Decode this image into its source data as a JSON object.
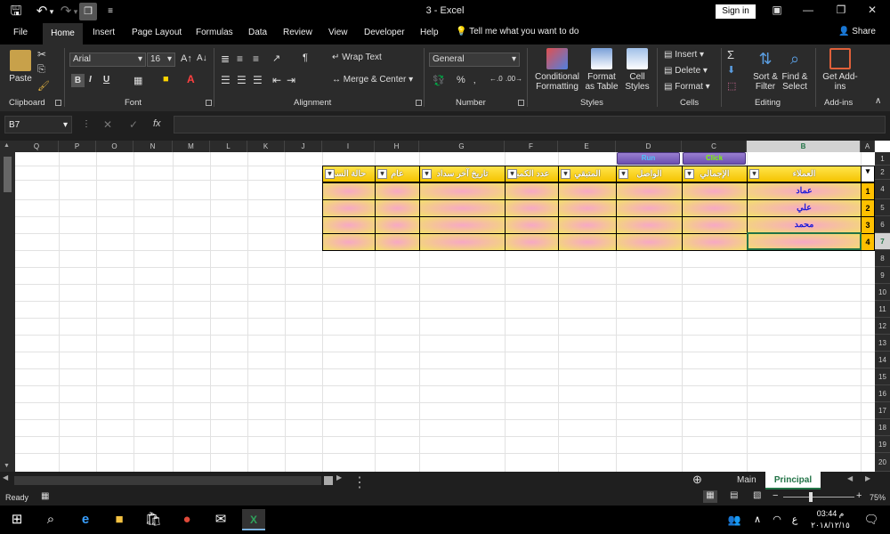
{
  "titlebar": {
    "doc_title": "3 - Excel",
    "signin_label": "Sign in"
  },
  "tabs": [
    "File",
    "Home",
    "Insert",
    "Page Layout",
    "Formulas",
    "Data",
    "Review",
    "View",
    "Developer",
    "Help"
  ],
  "tell_me": "Tell me what you want to do",
  "share_label": "Share",
  "ribbon": {
    "clipboard": {
      "label": "Clipboard",
      "paste": "Paste"
    },
    "font": {
      "label": "Font",
      "name": "Arial",
      "size": "16",
      "bold": "B",
      "italic": "I",
      "underline": "U"
    },
    "alignment": {
      "label": "Alignment",
      "wrap": "Wrap Text",
      "merge": "Merge & Center"
    },
    "number": {
      "label": "Number",
      "format": "General",
      "percent": "%"
    },
    "styles": {
      "label": "Styles",
      "conditional": "Conditional Formatting",
      "format_table": "Format as Table",
      "cell_styles": "Cell Styles"
    },
    "cells": {
      "label": "Cells",
      "insert": "Insert",
      "delete": "Delete",
      "format": "Format"
    },
    "editing": {
      "label": "Editing",
      "sort": "Sort & Filter",
      "find": "Find & Select"
    },
    "addins": {
      "label": "Add-ins",
      "get": "Get Add-ins"
    }
  },
  "formula_bar": {
    "name_box": "B7",
    "fx": "fx",
    "value": ""
  },
  "columns": [
    "Q",
    "P",
    "O",
    "N",
    "M",
    "L",
    "K",
    "J",
    "I",
    "H",
    "G",
    "F",
    "E",
    "D",
    "C",
    "B",
    "A"
  ],
  "rows": [
    "1",
    "2",
    "4",
    "5",
    "6",
    "7",
    "8",
    "9",
    "10",
    "11",
    "12",
    "13",
    "14",
    "15",
    "16",
    "17",
    "18",
    "19",
    "20"
  ],
  "buttons": {
    "run": "Run",
    "click": "Click"
  },
  "table": {
    "headers": [
      "العملاء",
      "الإجمالي",
      "الواصل",
      "المتبقي",
      "عدد الكمبا",
      "تاريخ آخر سداد",
      "عام",
      "حالة السد"
    ],
    "row_numbers": [
      "1",
      "2",
      "3",
      "4"
    ],
    "customers": [
      "عماد",
      "علي",
      "محمد",
      ""
    ]
  },
  "sheets": [
    "Main",
    "Principal"
  ],
  "status": {
    "ready": "Ready",
    "zoom": "75%"
  },
  "taskbar": {
    "time": "03:44 م",
    "date": "٢٠١٨/١٢/١٥"
  },
  "colors": {
    "accent_green": "#217346",
    "header_yellow": "#ffd500",
    "customer_blue": "#1c1cd6"
  }
}
